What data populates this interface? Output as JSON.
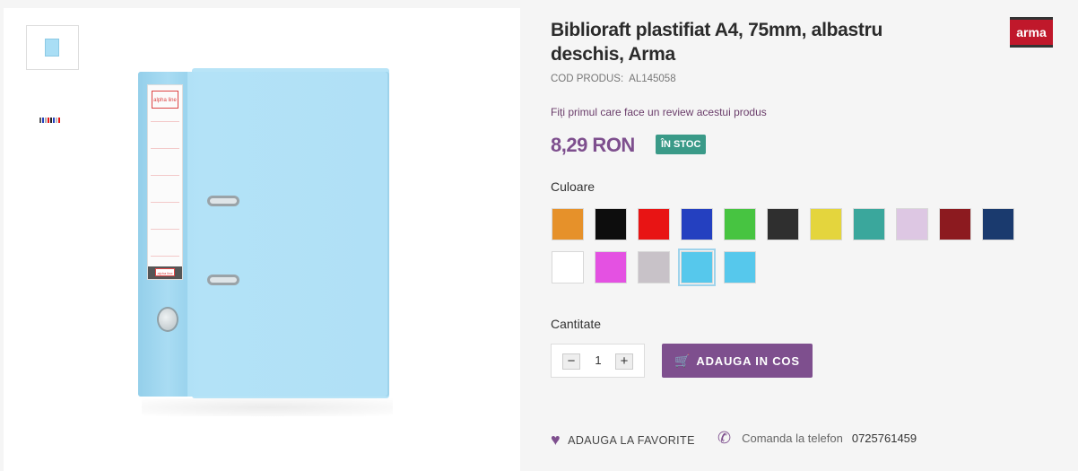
{
  "product": {
    "title": "Biblioraft plastifiat A4, 75mm, albastru deschis, Arma",
    "code_label": "COD PRODUS:",
    "code_value": "AL145058",
    "brand": "arma",
    "review_link": "Fiți primul care face un review acestui produs",
    "price": "8,29 RON",
    "stock_badge": "ÎN STOC"
  },
  "colors": {
    "label": "Culoare",
    "swatches": [
      "#e6912a",
      "#0d0d0d",
      "#e81414",
      "#2440c0",
      "#47c441",
      "#2f2f2f",
      "#e4d53d",
      "#3aa79c",
      "#ddc7e3",
      "#8c1a1f",
      "#1a3a6e",
      "#ffffff",
      "#e451e2",
      "#c8c2c8",
      "#56c8ec",
      "#56c8ec"
    ],
    "selected_index": 14
  },
  "quantity": {
    "label": "Cantitate",
    "value": "1",
    "minus": "−",
    "plus": "+"
  },
  "actions": {
    "add_to_cart": "ADAUGA IN COS",
    "favorite": "ADAUGA LA FAVORITE",
    "phone_label": "Comanda la telefon",
    "phone_number": "0725761459"
  },
  "image_labels": {
    "spine_logo": "alpha line",
    "spine_tag": "alpha line"
  },
  "icons": {
    "cart": "cart-icon",
    "heart": "heart-icon",
    "phone": "phone-icon"
  }
}
